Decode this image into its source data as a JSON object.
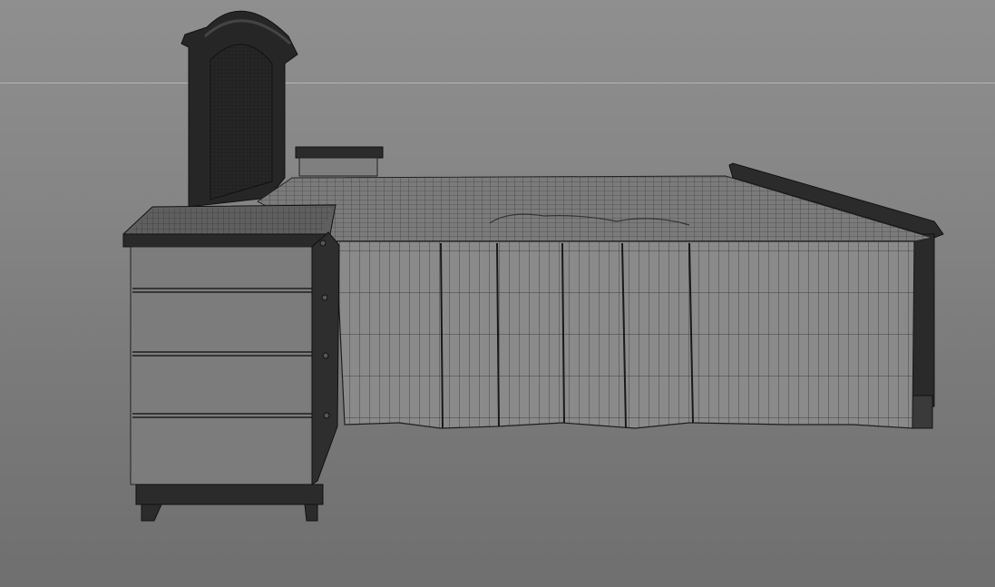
{
  "viewport": {
    "label": "",
    "display_mode": "wireframe-on-shaded",
    "colors": {
      "background_top": "#8f8f8f",
      "background_bottom": "#6f6f6f",
      "horizon_line": "#bdbdbd",
      "surface": "#7d7d7d",
      "wire": "#1e1e1e",
      "dark_trim": "#2a2a2a"
    }
  },
  "scene": {
    "objects": [
      "mirror",
      "nightstand",
      "bed",
      "headboard",
      "bedspread",
      "chest-of-drawers"
    ]
  }
}
